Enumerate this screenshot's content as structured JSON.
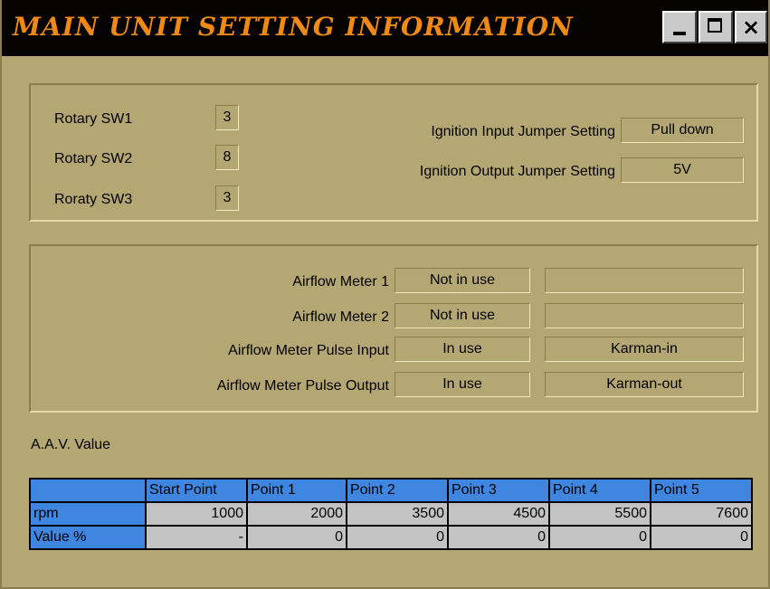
{
  "window": {
    "title": "MAIN UNIT SETTING INFORMATION",
    "minimize_icon": "minimize-icon",
    "maximize_icon": "maximize-icon",
    "close_glyph": "×"
  },
  "rotary": {
    "sw1": {
      "label": "Rotary SW1",
      "value": "3"
    },
    "sw2": {
      "label": "Rotary SW2",
      "value": "8"
    },
    "sw3": {
      "label": "Roraty SW3",
      "value": "3"
    }
  },
  "ignition": {
    "input": {
      "label": "Ignition Input Jumper Setting",
      "value": "Pull down"
    },
    "output": {
      "label": "Ignition Output Jumper Setting",
      "value": "5V"
    }
  },
  "airflow": {
    "meter1": {
      "label": "Airflow Meter 1",
      "status": "Not in use",
      "type": ""
    },
    "meter2": {
      "label": "Airflow Meter 2",
      "status": "Not in use",
      "type": ""
    },
    "pulse_input": {
      "label": "Airflow Meter Pulse Input",
      "status": "In use",
      "type": "Karman-in"
    },
    "pulse_output": {
      "label": "Airflow Meter Pulse Output",
      "status": "In use",
      "type": "Karman-out"
    }
  },
  "aav": {
    "title": "A.A.V. Value",
    "columns": [
      "",
      "Start Point",
      "Point 1",
      "Point 2",
      "Point 3",
      "Point 4",
      "Point 5"
    ],
    "rows": [
      {
        "label": "rpm",
        "values": [
          "1000",
          "2000",
          "3500",
          "4500",
          "5500",
          "7600"
        ]
      },
      {
        "label": "Value %",
        "values": [
          "-",
          "0",
          "0",
          "0",
          "0",
          "0"
        ]
      }
    ]
  }
}
